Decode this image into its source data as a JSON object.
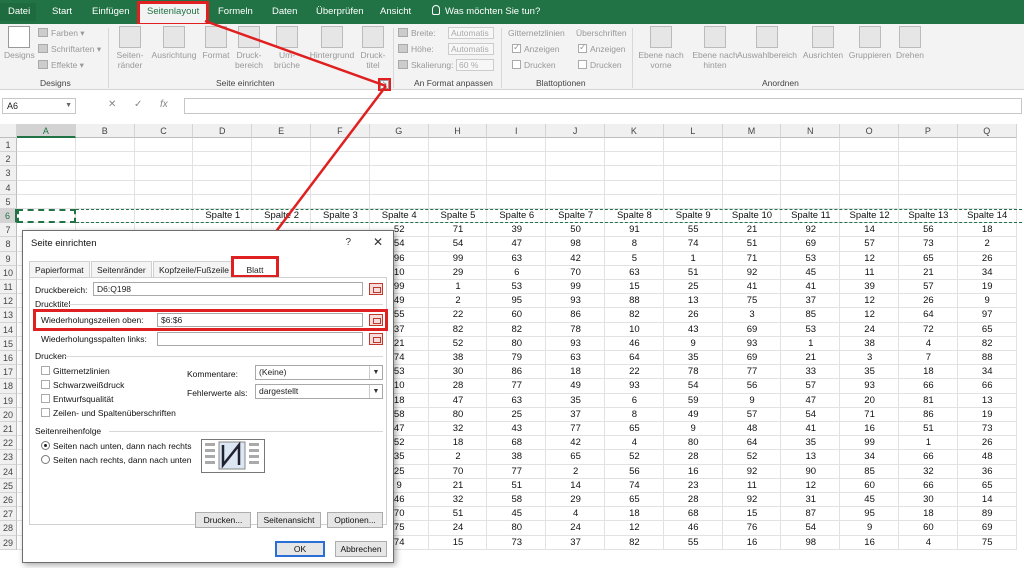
{
  "tabs": [
    {
      "label": "Datei"
    },
    {
      "label": "Start"
    },
    {
      "label": "Einfügen"
    },
    {
      "label": "Seitenlayout"
    },
    {
      "label": "Formeln"
    },
    {
      "label": "Daten"
    },
    {
      "label": "Überprüfen"
    },
    {
      "label": "Ansicht"
    }
  ],
  "tell_me": "Was möchten Sie tun?",
  "ribbon": {
    "designs_group": "Designs",
    "designs_btn": "Designs",
    "farben": "Farben",
    "schriftarten": "Schriftarten",
    "effekte": "Effekte",
    "seite_group": "Seite einrichten",
    "seitenraender": "Seiten-\nränder",
    "ausrichtung": "Ausrichtung",
    "format": "Format",
    "druckbereich": "Druck-\nbereich",
    "umbrueche": "Um-\nbrüche",
    "hintergrund": "Hintergrund",
    "drucktitel": "Druck-\ntitel",
    "breite": "Breite:",
    "hoehe": "Höhe:",
    "skalierung": "Skalierung:",
    "automatisch": "Automatis",
    "skalierung_val": "60 %",
    "format_group": "An Format anpassen",
    "gitternetz": "Gitternetzlinien",
    "ueberschriften": "Überschriften",
    "anzeigen": "Anzeigen",
    "drucken": "Drucken",
    "blatt_group": "Blattoptionen",
    "ebene_vorne": "Ebene nach\nvorne",
    "ebene_hinten": "Ebene nach\nhinten",
    "auswahlbereich": "Auswahlbereich",
    "ausrichten": "Ausrichten",
    "gruppieren": "Gruppieren",
    "drehen": "Drehen",
    "anordnen_group": "Anordnen"
  },
  "namebox": "A6",
  "columns": [
    "A",
    "B",
    "C",
    "D",
    "E",
    "F",
    "G",
    "H",
    "I",
    "J",
    "K",
    "L",
    "M",
    "N",
    "O",
    "P",
    "Q"
  ],
  "rows": [
    "1",
    "2",
    "3",
    "4",
    "5",
    "6",
    "7",
    "8",
    "9",
    "10",
    "11",
    "12",
    "13",
    "14",
    "15",
    "16",
    "17",
    "18",
    "19",
    "20",
    "21",
    "22",
    "23",
    "24",
    "25",
    "26",
    "27",
    "28",
    "29"
  ],
  "header_row": [
    "Spalte 1",
    "Spalte 2",
    "Spalte 3",
    "Spalte 4",
    "Spalte 5",
    "Spalte 6",
    "Spalte 7",
    "Spalte 8",
    "Spalte 9",
    "Spalte 10",
    "Spalte 11",
    "Spalte 12",
    "Spalte 13",
    "Spalte 14"
  ],
  "data_rows": [
    [
      "52",
      "71",
      "39",
      "50",
      "91",
      "55",
      "21",
      "92",
      "14",
      "56",
      "18"
    ],
    [
      "54",
      "54",
      "47",
      "98",
      "8",
      "74",
      "51",
      "69",
      "57",
      "73",
      "2"
    ],
    [
      "96",
      "99",
      "63",
      "42",
      "5",
      "1",
      "71",
      "53",
      "12",
      "65",
      "26"
    ],
    [
      "10",
      "29",
      "6",
      "70",
      "63",
      "51",
      "92",
      "45",
      "11",
      "21",
      "34"
    ],
    [
      "99",
      "1",
      "53",
      "99",
      "15",
      "25",
      "41",
      "41",
      "39",
      "57",
      "19"
    ],
    [
      "49",
      "2",
      "95",
      "93",
      "88",
      "13",
      "75",
      "37",
      "12",
      "26",
      "9"
    ],
    [
      "55",
      "22",
      "60",
      "86",
      "82",
      "26",
      "3",
      "85",
      "12",
      "64",
      "97"
    ],
    [
      "37",
      "82",
      "82",
      "78",
      "10",
      "43",
      "69",
      "53",
      "24",
      "72",
      "65"
    ],
    [
      "21",
      "52",
      "80",
      "93",
      "46",
      "9",
      "93",
      "1",
      "38",
      "4",
      "82"
    ],
    [
      "74",
      "38",
      "79",
      "63",
      "64",
      "35",
      "69",
      "21",
      "3",
      "7",
      "88"
    ],
    [
      "53",
      "30",
      "86",
      "18",
      "22",
      "78",
      "77",
      "33",
      "35",
      "18",
      "34"
    ],
    [
      "10",
      "28",
      "77",
      "49",
      "93",
      "54",
      "56",
      "57",
      "93",
      "66",
      "66"
    ],
    [
      "18",
      "47",
      "63",
      "35",
      "6",
      "59",
      "9",
      "47",
      "20",
      "81",
      "13"
    ],
    [
      "58",
      "80",
      "25",
      "37",
      "8",
      "49",
      "57",
      "54",
      "71",
      "86",
      "19"
    ],
    [
      "47",
      "32",
      "43",
      "77",
      "65",
      "9",
      "48",
      "41",
      "16",
      "51",
      "73"
    ],
    [
      "52",
      "18",
      "68",
      "42",
      "4",
      "80",
      "64",
      "35",
      "99",
      "1",
      "26"
    ],
    [
      "35",
      "2",
      "38",
      "65",
      "52",
      "28",
      "52",
      "13",
      "34",
      "66",
      "48"
    ],
    [
      "25",
      "70",
      "77",
      "2",
      "56",
      "16",
      "92",
      "90",
      "85",
      "32",
      "36"
    ],
    [
      "9",
      "21",
      "51",
      "14",
      "74",
      "23",
      "11",
      "12",
      "60",
      "66",
      "65"
    ],
    [
      "46",
      "32",
      "58",
      "29",
      "65",
      "28",
      "92",
      "31",
      "45",
      "30",
      "14"
    ],
    [
      "70",
      "51",
      "45",
      "4",
      "18",
      "68",
      "15",
      "87",
      "95",
      "18",
      "89"
    ],
    [
      "75",
      "24",
      "80",
      "24",
      "12",
      "46",
      "76",
      "54",
      "9",
      "60",
      "69"
    ],
    [
      "74",
      "15",
      "73",
      "37",
      "82",
      "55",
      "16",
      "98",
      "16",
      "4",
      "75"
    ]
  ],
  "dialog": {
    "title": "Seite einrichten",
    "help": "?",
    "close": "✕",
    "tabs": [
      "Papierformat",
      "Seitenränder",
      "Kopfzeile/Fußzeile",
      "Blatt"
    ],
    "druckbereich_label": "Druckbereich:",
    "druckbereich_value": "D6:Q198",
    "drucktitel_label": "Drucktitel",
    "wdh_zeilen_label": "Wiederholungszeilen oben:",
    "wdh_zeilen_value": "$6:$6",
    "wdh_spalten_label": "Wiederholungsspalten links:",
    "wdh_spalten_value": "",
    "drucken_label": "Drucken",
    "cb_gitter": "Gitternetzlinien",
    "cb_sw": "Schwarzweißdruck",
    "cb_entwurf": "Entwurfsqualität",
    "cb_zeilen": "Zeilen- und Spaltenüberschriften",
    "kommentare_label": "Kommentare:",
    "kommentare_value": "(Keine)",
    "fehler_label": "Fehlerwerte als:",
    "fehler_value": "dargestellt",
    "reihenfolge_label": "Seitenreihenfolge",
    "radio1": "Seiten nach unten, dann nach rechts",
    "radio2": "Seiten nach rechts, dann nach unten",
    "btn_drucken": "Drucken...",
    "btn_seitenansicht": "Seitenansicht",
    "btn_optionen": "Optionen...",
    "btn_ok": "OK",
    "btn_abbrechen": "Abbrechen"
  },
  "colors": {
    "excel_green": "#217346",
    "highlight_red": "#e02020"
  }
}
